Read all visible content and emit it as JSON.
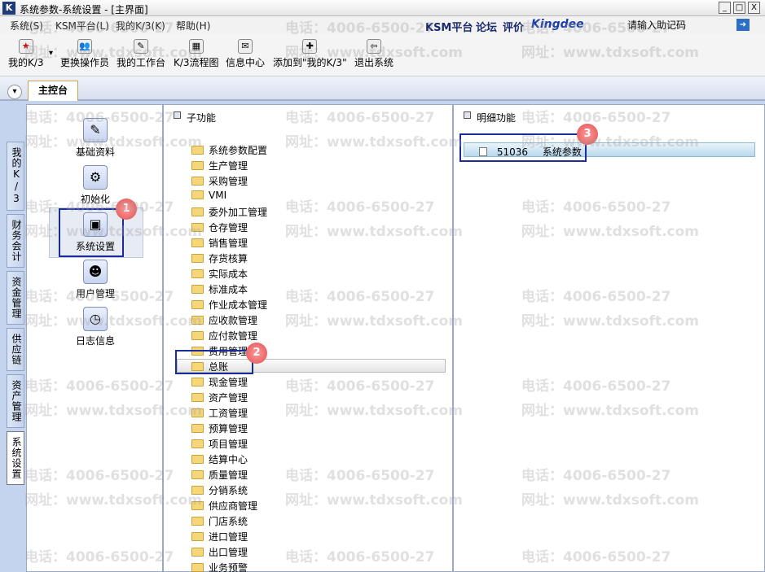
{
  "window": {
    "app_icon_text": "K",
    "title": "系统参数-系统设置 - [主界面]",
    "min": "_",
    "max": "□",
    "close": "X"
  },
  "menu": {
    "items": [
      "系统(S)",
      "KSM平台(L)",
      "我的K/3(K)",
      "帮助(H)"
    ],
    "brand_ksm": "KSM平台",
    "brand_forum": "论坛",
    "brand_rate": "评价",
    "brand_kingdee": "Kingdee",
    "help_placeholder": "请输入助记码"
  },
  "toolbar": {
    "items": [
      "我的K/3",
      "更换操作员",
      "我的工作台",
      "K/3流程图",
      "信息中心",
      "添加到\"我的K/3\"",
      "退出系统"
    ],
    "dropdown": "▾"
  },
  "tabbar": {
    "collapse": "▾",
    "main_tab": "主控台"
  },
  "vtabs": [
    "我的K/3",
    "财务会计",
    "资金管理",
    "供应链",
    "资产管理",
    "系统设置"
  ],
  "left_panel": {
    "items": [
      "基础资料",
      "初始化",
      "系统设置",
      "用户管理",
      "日志信息"
    ]
  },
  "mid_panel": {
    "header": "子功能",
    "folders": [
      "系统参数配置",
      "生产管理",
      "采购管理",
      "VMI",
      "委外加工管理",
      "仓存管理",
      "销售管理",
      "存货核算",
      "实际成本",
      "标准成本",
      "作业成本管理",
      "应收款管理",
      "应付款管理",
      "费用管理",
      "总账",
      "现金管理",
      "资产管理",
      "工资管理",
      "预算管理",
      "项目管理",
      "结算中心",
      "质量管理",
      "分销系统",
      "供应商管理",
      "门店系统",
      "进口管理",
      "出口管理",
      "业务预警"
    ]
  },
  "right_panel": {
    "header": "明细功能",
    "detail_code": "51036",
    "detail_label": "系统参数"
  },
  "annotations": {
    "badge1": "1",
    "badge2": "2",
    "badge3": "3"
  },
  "watermark": {
    "phone": "电话：4006-6500-27",
    "site": "网址：www.tdxsoft.com"
  }
}
